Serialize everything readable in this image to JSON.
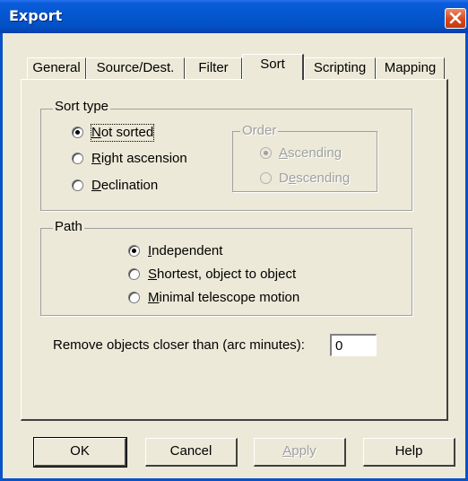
{
  "window": {
    "title": "Export"
  },
  "tabs": [
    {
      "label": "General"
    },
    {
      "label": "Source/Dest."
    },
    {
      "label": "Filter"
    },
    {
      "label": "Sort",
      "selected": true
    },
    {
      "label": "Scripting"
    },
    {
      "label": "Mapping"
    }
  ],
  "sort_type": {
    "label": "Sort type",
    "options": [
      {
        "pre": "",
        "key": "N",
        "post": "ot sorted",
        "checked": true
      },
      {
        "pre": "",
        "key": "R",
        "post": "ight ascension",
        "checked": false
      },
      {
        "pre": "",
        "key": "D",
        "post": "eclination",
        "checked": false
      }
    ]
  },
  "order": {
    "label": "Order",
    "enabled": false,
    "options": [
      {
        "pre": "",
        "key": "A",
        "post": "scending",
        "checked": true
      },
      {
        "pre": "D",
        "key": "e",
        "post": "scending",
        "checked": false
      }
    ]
  },
  "path": {
    "label": "Path",
    "options": [
      {
        "pre": "",
        "key": "I",
        "post": "ndependent",
        "checked": true
      },
      {
        "pre": "",
        "key": "S",
        "post": "hortest, object to object",
        "checked": false
      },
      {
        "pre": "",
        "key": "M",
        "post": "inimal telescope motion",
        "checked": false
      }
    ]
  },
  "remove_objects": {
    "label": "Remove objects closer than (arc minutes):",
    "value": "0"
  },
  "buttons": {
    "ok": "OK",
    "cancel": "Cancel",
    "apply_key": "A",
    "apply_rest": "pply",
    "help": "Help"
  },
  "colors": {
    "titlebar": "#0456d0",
    "face": "#ece9d8",
    "close": "#d6481c"
  },
  "icons": {
    "close": "close-icon"
  }
}
